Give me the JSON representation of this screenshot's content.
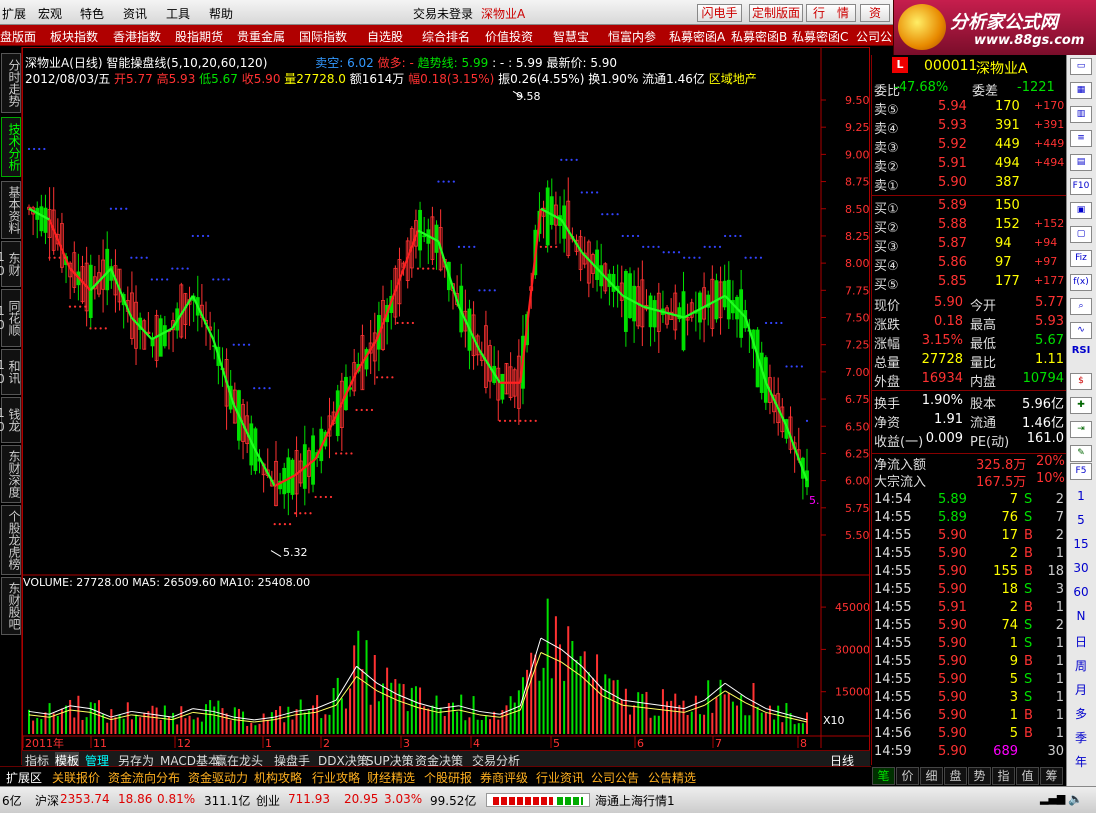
{
  "menu": {
    "items": [
      "扩展",
      "宏观",
      "特色",
      "资讯",
      "工具",
      "帮助"
    ],
    "login_status": "交易未登录",
    "title_stock": "深物业A"
  },
  "top_buttons": [
    "闪电手",
    "定制版面",
    "行　情",
    "资"
  ],
  "logo": {
    "brand": "分析家公式网",
    "url_text": "www.88gs.com"
  },
  "nav": {
    "items": [
      "盘版面",
      "板块指数",
      "香港指数",
      "股指期货",
      "贵重金属",
      "国际指数",
      "自选股",
      "综合排名",
      "价值投资",
      "智慧宝",
      "恒富内参",
      "私募密函A",
      "私募密函B",
      "私募密函C",
      "公司公"
    ]
  },
  "left_tabs": [
    "分时走势",
    "技术分析",
    "基本资料",
    "东财10",
    "同花顺10",
    "和讯10",
    "钱龙10",
    "东财深度",
    "个股龙虎榜",
    "东财股吧"
  ],
  "chart_header": {
    "line1_name": "深物业A(日线)",
    "line1_indicator": "智能操盘线(5,10,20,60,120)",
    "line1_sell": "卖空: 6.02",
    "line1_long": "做多: -",
    "line1_trend": "趋势线: 5.99",
    "line1_trend2": ": - : 5.99",
    "line1_latest": "最新价: 5.90",
    "line2_date": "2012/08/03/五",
    "line2_open": "开5.77",
    "line2_high": "高5.93",
    "line2_low": "低5.67",
    "line2_close": "收5.90",
    "line2_vol": "量27728.0",
    "line2_amt": "额1614万",
    "line2_range": "幅0.18(3.15%)",
    "line2_amp": "振0.26(4.55%)",
    "line2_turn": "换1.90%",
    "line2_float": "流通1.46亿",
    "line2_sector": "区域地产"
  },
  "price_axis": [
    "9.50",
    "9.25",
    "9.00",
    "8.75",
    "8.50",
    "8.25",
    "8.00",
    "7.75",
    "7.50",
    "7.25",
    "7.00",
    "6.75",
    "6.50",
    "6.25",
    "6.00",
    "5.75",
    "5.50"
  ],
  "price_annotations": {
    "high": "9.58",
    "low": "5.32",
    "last_marker": "5."
  },
  "volume": {
    "header": "VOLUME: 27728.00  MA5: 26509.60  MA10: 25408.00",
    "axis": [
      "45000",
      "30000",
      "15000"
    ],
    "unit": "X10"
  },
  "date_axis": [
    "2011年",
    "11",
    "12",
    "1",
    "2",
    "3",
    "4",
    "5",
    "6",
    "7",
    "8"
  ],
  "period_label": "日线",
  "bottom_tabs": [
    "指标",
    "模板",
    "管理",
    "另存为",
    "MACD基本",
    "赢在龙头",
    "操盘手",
    "DDX决策",
    "SUP决策",
    "资金决策",
    "交易分析"
  ],
  "info_tabs": [
    "扩展区",
    "关联报价",
    "资金流向分布",
    "资金驱动力",
    "机构攻略",
    "行业攻略",
    "财经精选",
    "个股研报",
    "券商评级",
    "行业资讯",
    "公司公告",
    "公告精选"
  ],
  "quote": {
    "code": "000011",
    "name": "深物业A",
    "wb_label": "委比",
    "wb_value": "-47.68%",
    "wc_label": "委差",
    "wc_value": "-1221",
    "sells": [
      {
        "label": "卖⑤",
        "price": "5.94",
        "vol": "170",
        "chg": "+170"
      },
      {
        "label": "卖④",
        "price": "5.93",
        "vol": "391",
        "chg": "+391"
      },
      {
        "label": "卖③",
        "price": "5.92",
        "vol": "449",
        "chg": "+449"
      },
      {
        "label": "卖②",
        "price": "5.91",
        "vol": "494",
        "chg": "+494"
      },
      {
        "label": "卖①",
        "price": "5.90",
        "vol": "387",
        "chg": ""
      }
    ],
    "buys": [
      {
        "label": "买①",
        "price": "5.89",
        "vol": "150",
        "chg": ""
      },
      {
        "label": "买②",
        "price": "5.88",
        "vol": "152",
        "chg": "+152"
      },
      {
        "label": "买③",
        "price": "5.87",
        "vol": "94",
        "chg": "+94"
      },
      {
        "label": "买④",
        "price": "5.86",
        "vol": "97",
        "chg": "+97"
      },
      {
        "label": "买⑤",
        "price": "5.85",
        "vol": "177",
        "chg": "+177"
      }
    ],
    "stats": [
      {
        "l1": "现价",
        "v1": "5.90",
        "c1": "red",
        "l2": "今开",
        "v2": "5.77",
        "c2": "red"
      },
      {
        "l1": "涨跌",
        "v1": "0.18",
        "c1": "red",
        "l2": "最高",
        "v2": "5.93",
        "c2": "red"
      },
      {
        "l1": "涨幅",
        "v1": "3.15%",
        "c1": "red",
        "l2": "最低",
        "v2": "5.67",
        "c2": "grn"
      },
      {
        "l1": "总量",
        "v1": "27728",
        "c1": "yel",
        "l2": "量比",
        "v2": "1.11",
        "c2": "yel"
      },
      {
        "l1": "外盘",
        "v1": "16934",
        "c1": "red",
        "l2": "内盘",
        "v2": "10794",
        "c2": "grn"
      },
      {
        "l1": "换手",
        "v1": "1.90%",
        "c1": "wht",
        "l2": "股本",
        "v2": "5.96亿",
        "c2": "wht"
      },
      {
        "l1": "净资",
        "v1": "1.91",
        "c1": "wht",
        "l2": "流通",
        "v2": "1.46亿",
        "c2": "wht"
      },
      {
        "l1": "收益(一)",
        "v1": "0.009",
        "c1": "wht",
        "l2": "PE(动)",
        "v2": "161.0",
        "c2": "wht"
      }
    ],
    "netflow_label": "净流入额",
    "netflow_value": "325.8万",
    "netflow_pct": "20%",
    "block_label": "大宗流入",
    "block_value": "167.5万",
    "block_pct": "10%"
  },
  "ticks": [
    {
      "t": "14:54",
      "p": "5.89",
      "v": "7",
      "d": "S",
      "n": "2"
    },
    {
      "t": "14:55",
      "p": "5.89",
      "v": "76",
      "d": "S",
      "n": "7"
    },
    {
      "t": "14:55",
      "p": "5.90",
      "v": "17",
      "d": "B",
      "n": "2"
    },
    {
      "t": "14:55",
      "p": "5.90",
      "v": "2",
      "d": "B",
      "n": "1"
    },
    {
      "t": "14:55",
      "p": "5.90",
      "v": "155",
      "d": "B",
      "n": "18"
    },
    {
      "t": "14:55",
      "p": "5.90",
      "v": "18",
      "d": "S",
      "n": "3"
    },
    {
      "t": "14:55",
      "p": "5.91",
      "v": "2",
      "d": "B",
      "n": "1"
    },
    {
      "t": "14:55",
      "p": "5.90",
      "v": "74",
      "d": "S",
      "n": "2"
    },
    {
      "t": "14:55",
      "p": "5.90",
      "v": "1",
      "d": "S",
      "n": "1"
    },
    {
      "t": "14:55",
      "p": "5.90",
      "v": "9",
      "d": "B",
      "n": "1"
    },
    {
      "t": "14:55",
      "p": "5.90",
      "v": "5",
      "d": "S",
      "n": "1"
    },
    {
      "t": "14:55",
      "p": "5.90",
      "v": "3",
      "d": "S",
      "n": "1"
    },
    {
      "t": "14:56",
      "p": "5.90",
      "v": "1",
      "d": "B",
      "n": "1"
    },
    {
      "t": "14:56",
      "p": "5.90",
      "v": "5",
      "d": "B",
      "n": "1"
    },
    {
      "t": "14:59",
      "p": "5.90",
      "v": "689",
      "d": "",
      "n": "30"
    }
  ],
  "panel_tabs": [
    "笔",
    "价",
    "细",
    "盘",
    "势",
    "指",
    "值",
    "筹"
  ],
  "side_icon_texts": [
    "RSI",
    "F5",
    "1",
    "5",
    "15",
    "30",
    "60",
    "N",
    "日",
    "周",
    "月",
    "多",
    "季",
    "年"
  ],
  "status": {
    "s1_prefix": "6亿",
    "sh_label": "沪深",
    "sh_index": "2353.74",
    "sh_change": "18.86",
    "sh_pct": "0.81%",
    "sh_amt": "311.1亿",
    "cy_label": "创业",
    "cy_index": "711.93",
    "cy_change": "20.95",
    "cy_pct": "3.03%",
    "cy_amt": "99.52亿",
    "broker": "海通上海行情1"
  },
  "chart_data": {
    "type": "candlestick",
    "title": "深物业A(日线)",
    "ylim": [
      5.3,
      9.6
    ],
    "y_ticks": [
      5.5,
      5.75,
      6.0,
      6.25,
      6.5,
      6.75,
      7.0,
      7.25,
      7.5,
      7.75,
      8.0,
      8.25,
      8.5,
      8.75,
      9.0,
      9.25,
      9.5
    ],
    "x_labels": [
      "2011年",
      "11",
      "12",
      "1",
      "2",
      "3",
      "4",
      "5",
      "6",
      "7",
      "8"
    ],
    "trend_line": [
      8.5,
      8.4,
      7.95,
      7.75,
      7.95,
      7.5,
      7.3,
      7.4,
      7.7,
      7.3,
      6.7,
      6.3,
      5.95,
      6.05,
      6.2,
      6.6,
      7.0,
      7.3,
      7.8,
      8.3,
      8.2,
      7.6,
      7.2,
      6.9,
      6.9,
      8.5,
      8.4,
      8.1,
      7.9,
      7.7,
      7.6,
      7.55,
      7.5,
      7.6,
      7.7,
      7.5,
      6.9,
      6.5,
      6.0
    ],
    "trend_up_segments": [
      [
        1,
        3
      ],
      [
        12,
        19
      ],
      [
        23,
        25
      ]
    ],
    "last_close": 5.9,
    "high_mark": 9.58,
    "low_mark": 5.32,
    "volume_ma5": [
      8,
      7,
      10,
      9,
      6,
      8,
      7,
      6,
      9,
      8,
      6,
      5,
      6,
      8,
      9,
      12,
      24,
      18,
      14,
      11,
      9,
      10,
      8,
      7,
      10,
      34,
      30,
      24,
      16,
      12,
      11,
      10,
      9,
      12,
      18,
      13,
      9,
      7,
      5
    ]
  }
}
